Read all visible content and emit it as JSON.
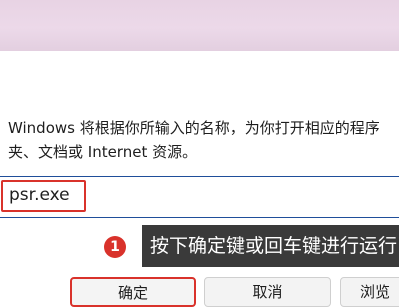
{
  "dialog": {
    "description": "Windows 将根据你所输入的名称，为你打开相应的程序\n夹、文档或 Internet 资源。",
    "open_field": {
      "value": "psr.exe"
    },
    "buttons": {
      "ok": "确定",
      "cancel": "取消",
      "browse": "浏览"
    }
  },
  "annotation": {
    "step_number": "1",
    "tip": "按下确定键或回车键进行运行"
  },
  "colors": {
    "highlight": "#d9322b",
    "tip_background": "#3a3a3a",
    "top_band": "#ecd9e9"
  }
}
